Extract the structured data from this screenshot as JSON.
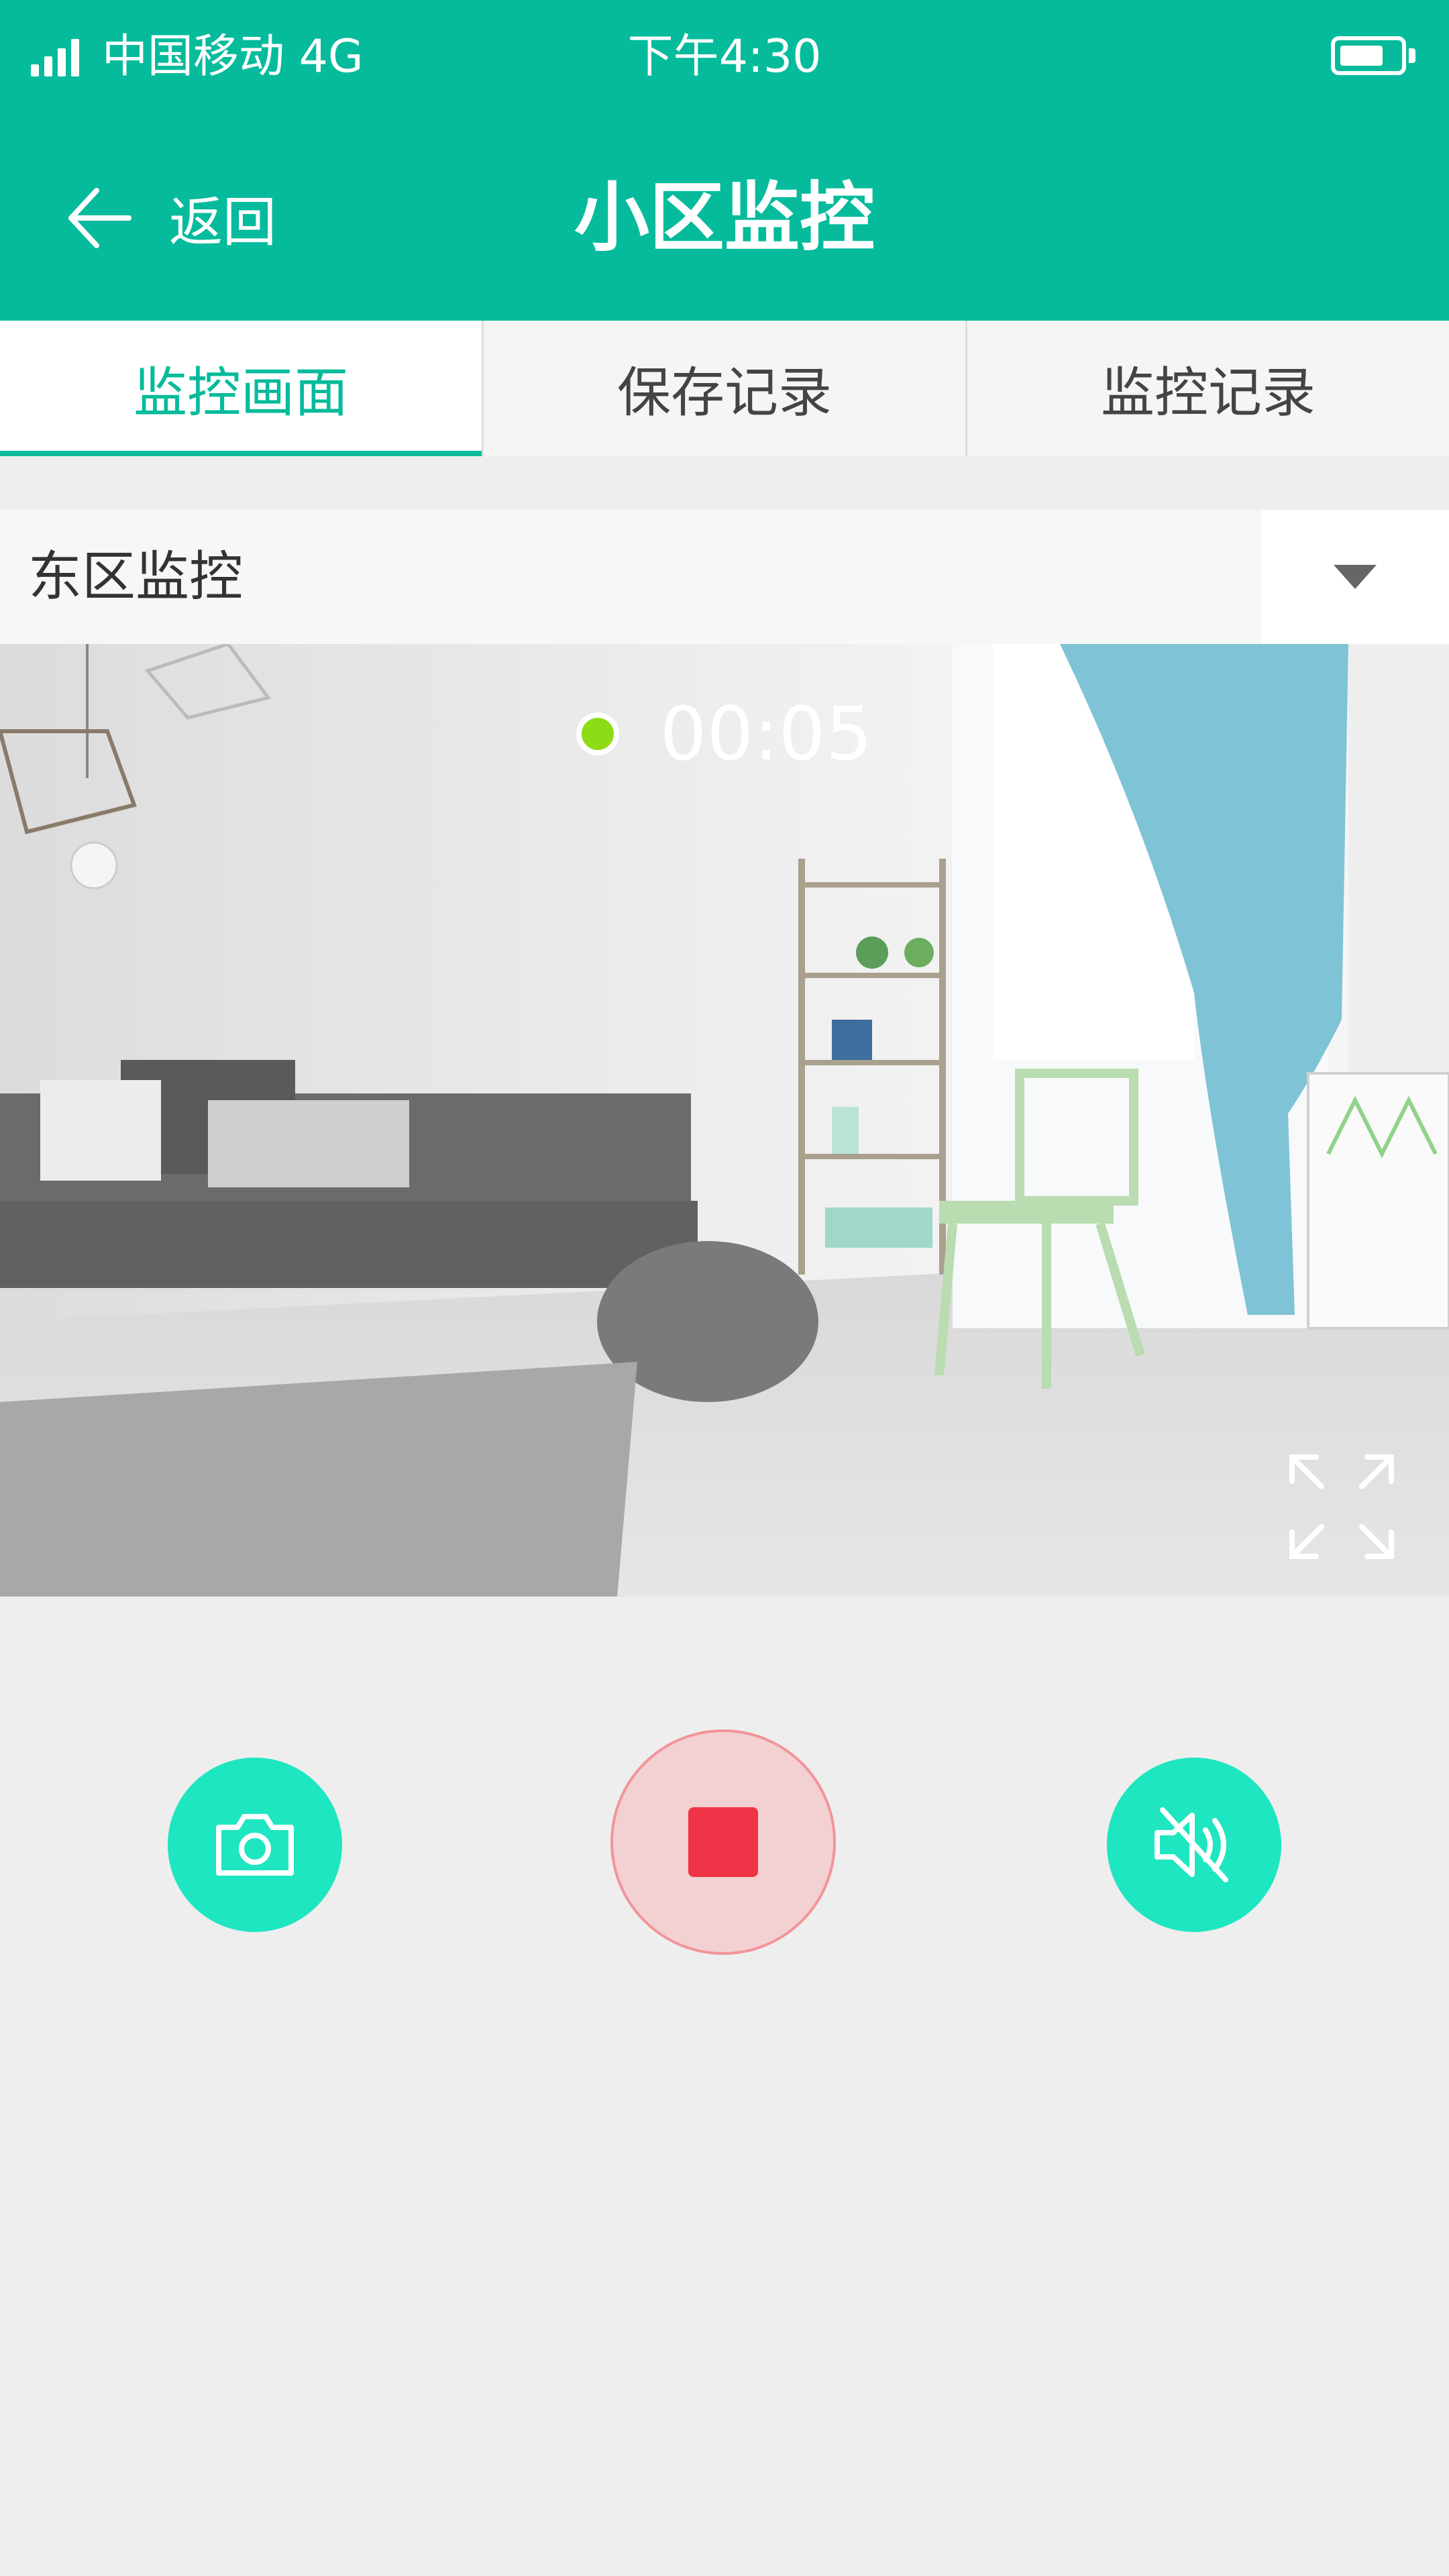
{
  "status_bar": {
    "carrier": "中国移动  4G",
    "time": "下午4:30",
    "battery_level": 0.75
  },
  "nav": {
    "back_label": "返回",
    "title": "小区监控"
  },
  "tabs": [
    {
      "label": "监控画面",
      "active": true
    },
    {
      "label": "保存记录",
      "active": false
    },
    {
      "label": "监控记录",
      "active": false
    }
  ],
  "selector": {
    "value": "东区监控"
  },
  "video": {
    "recording_time": "00:05"
  },
  "colors": {
    "primary": "#05bb9b",
    "accent": "#1ee6c1",
    "record_red": "#ee3446",
    "record_indicator": "#8ddc15"
  },
  "icons": [
    "signal-icon",
    "battery-icon",
    "back-arrow-icon",
    "dropdown-arrow-icon",
    "fullscreen-icon",
    "camera-icon",
    "stop-icon",
    "mute-icon"
  ]
}
